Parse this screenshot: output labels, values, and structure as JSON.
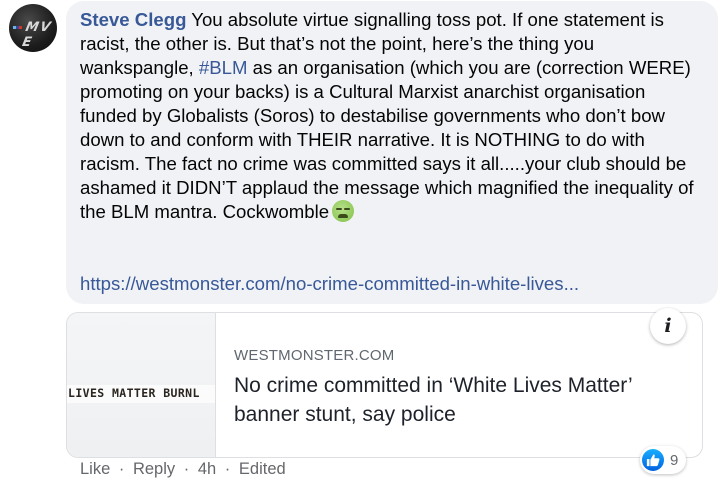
{
  "avatar": {
    "logo_text": "M V E"
  },
  "comment": {
    "author": "Steve Clegg",
    "text_part1": " You absolute virtue signalling toss pot. If one statement is racist, the other is. But that’s not the point, here’s the thing you wankspangle, ",
    "hashtag": "#BLM",
    "text_part2": " as an organisation (which you are (correction WERE) promoting on your backs) is a Cultural Marxist anarchist organisation funded by Globalists (Soros) to destabilise governments who don’t bow down to and conform with THEIR narrative. It is NOTHING to do with racism. The fact no crime was committed says it all.....your club should be ashamed it DIDN’T applaud the message which magnified the inequality of the BLM mantra. Cockwomble",
    "emoji_icon": "nauseated-face-icon",
    "link": "https://westmonster.com/no-crime-committed-in-white-lives..."
  },
  "preview": {
    "banner_text": "LIVES MATTER BURNL",
    "domain": "WESTMONSTER.COM",
    "title": "No crime committed in ‘White Lives Matter’ banner stunt, say police",
    "info_icon": "i"
  },
  "actions": {
    "like": "Like",
    "reply": "Reply",
    "time": "4h",
    "edited": "Edited",
    "separator": "·"
  },
  "reactions": {
    "icon": "like-icon",
    "count": "9"
  },
  "colors": {
    "link": "#385898",
    "bubble": "#f0f2f5",
    "meta": "#65676b",
    "like_blue": "#0f8cff"
  }
}
